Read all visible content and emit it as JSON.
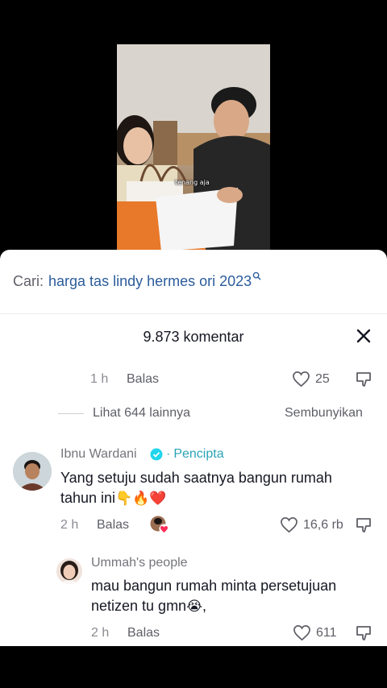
{
  "video": {
    "caption": "tenang aja"
  },
  "search": {
    "prefix": "Cari:",
    "query": "harga tas lindy hermes ori 2023",
    "icon": "search-icon"
  },
  "comments": {
    "count_label": "9.873 komentar",
    "close_icon": "close-icon"
  },
  "prev_comment_footer": {
    "time": "1 h",
    "reply_label": "Balas",
    "likes": "25"
  },
  "replies_control": {
    "view_more": "Lihat 644 lainnya",
    "hide": "Sembunyikan"
  },
  "comment_main": {
    "username": "Ibnu Wardani",
    "creator_label": "Pencipta",
    "text_line1": "Yang setuju sudah saatnya bangun rumah",
    "text_line2": "tahun ini",
    "emojis": "👇🔥❤️",
    "time": "2 h",
    "reply_label": "Balas",
    "likes": "16,6 rb",
    "verified_color": "#20d5ec",
    "heart_badge_color": "#fe2c55"
  },
  "comment_reply": {
    "username": "Ummah's people",
    "text_line1": "mau bangun rumah minta persetujuan",
    "text_line2": "netizen tu gmn",
    "emoji": "😭",
    "text_tail": ",",
    "time": "2 h",
    "reply_label": "Balas",
    "likes": "611"
  }
}
